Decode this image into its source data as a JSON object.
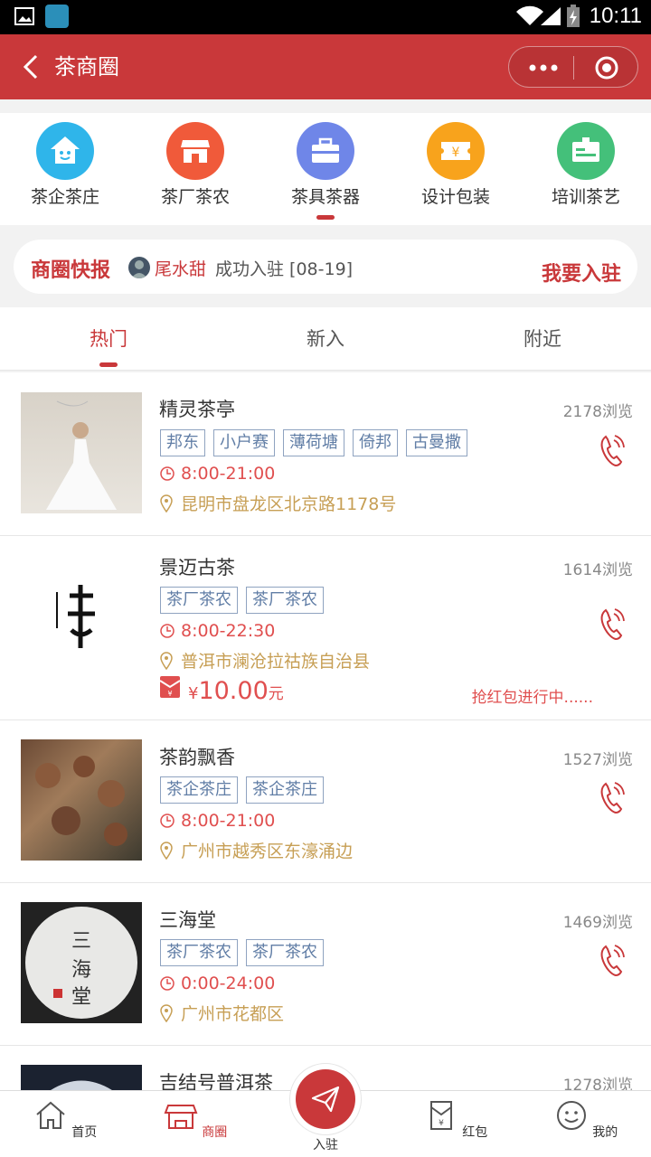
{
  "status_bar": {
    "time": "10:11"
  },
  "nav": {
    "title": "茶商圈"
  },
  "categories": [
    {
      "label": "茶企茶庄",
      "color": "#2fb5ea",
      "icon": "house-face-icon"
    },
    {
      "label": "茶厂茶农",
      "color": "#f05a3a",
      "icon": "shop-icon"
    },
    {
      "label": "茶具茶器",
      "color": "#6f86e8",
      "icon": "toolbox-icon"
    },
    {
      "label": "设计包装",
      "color": "#f8a31c",
      "icon": "ticket-yen-icon"
    },
    {
      "label": "培训茶艺",
      "color": "#44c07a",
      "icon": "id-card-icon"
    }
  ],
  "news": {
    "tag": "商圈快报",
    "name": "尾水甜",
    "text": "成功入驻 [08-19]",
    "action": "我要入驻"
  },
  "tabs": [
    {
      "label": "热门"
    },
    {
      "label": "新入"
    },
    {
      "label": "附近"
    }
  ],
  "items": [
    {
      "name": "精灵茶亭",
      "views": "2178浏览",
      "tags": [
        "邦东",
        "小户赛",
        "薄荷塘",
        "倚邦",
        "古曼撒"
      ],
      "hours": "8:00-21:00",
      "address": "昆明市盘龙区北京路1178号"
    },
    {
      "name": "景迈古茶",
      "views": "1614浏览",
      "tags": [
        "茶厂茶农",
        "茶厂茶农"
      ],
      "hours": "8:00-22:30",
      "address": "普洱市澜沧拉祜族自治县",
      "packet": {
        "currency": "¥",
        "amount": "10.00",
        "unit": "元",
        "status": "抢红包进行中......"
      }
    },
    {
      "name": "茶韵飘香",
      "views": "1527浏览",
      "tags": [
        "茶企茶庄",
        "茶企茶庄"
      ],
      "hours": "8:00-21:00",
      "address": "广州市越秀区东濠涌边"
    },
    {
      "name": "三海堂",
      "views": "1469浏览",
      "tags": [
        "茶厂茶农",
        "茶厂茶农"
      ],
      "hours": "0:00-24:00",
      "address": "广州市花都区"
    },
    {
      "name": "吉结号普洱茶",
      "views": "1278浏览",
      "tags": [],
      "hours": "",
      "address": ""
    }
  ],
  "bottom_nav": [
    {
      "label": "首页"
    },
    {
      "label": "商圈"
    },
    {
      "label": "入驻"
    },
    {
      "label": "红包"
    },
    {
      "label": "我的"
    }
  ]
}
